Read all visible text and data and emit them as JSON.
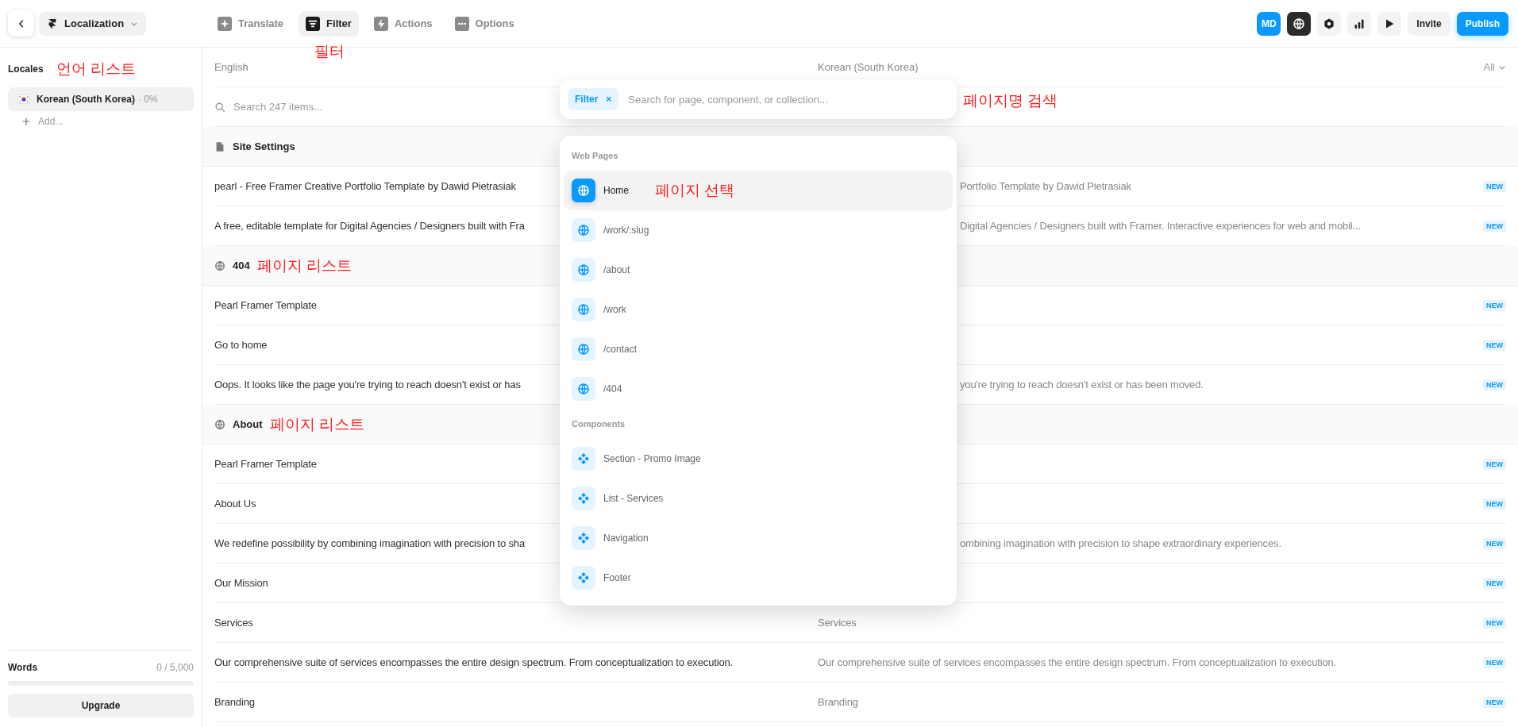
{
  "topbar": {
    "project": "Localization",
    "tabs": [
      {
        "label": "Translate",
        "selected": false
      },
      {
        "label": "Filter",
        "selected": true,
        "annotation": "필터"
      },
      {
        "label": "Actions",
        "selected": false
      },
      {
        "label": "Options",
        "selected": false
      }
    ],
    "avatar": "MD",
    "invite": "Invite",
    "publish": "Publish"
  },
  "sidebar": {
    "heading": "Locales",
    "annotation": "언어 리스트",
    "locales": [
      {
        "name": "Korean (South Korea)",
        "progress": "· 0%",
        "selected": true
      }
    ],
    "add": "Add...",
    "usage": {
      "label": "Words",
      "count": "0 / 5,000",
      "level": 0
    },
    "upgrade": "Upgrade"
  },
  "table": {
    "source_language": "English",
    "target_language": "Korean (South Korea)",
    "filter": "All",
    "search_placeholder": "Search 247 items...",
    "groups": [
      {
        "kind": "settings",
        "title": "Site Settings",
        "rows": [
          {
            "source": "pearl - Free Framer Creative Portfolio Template by Dawid Pietrasiak",
            "target": "Portfolio Template by Dawid Pietrasiak",
            "badge": "NEW"
          },
          {
            "source": "A free, editable template for Digital Agencies / Designers built with Fra",
            "target": "Digital Agencies / Designers built with Framer. Interactive experiences for web and mobil...",
            "badge": "NEW"
          }
        ]
      },
      {
        "kind": "page",
        "title": "404",
        "annotation": "페이지 리스트",
        "rows": [
          {
            "source": "Pearl Framer Template",
            "badge": "NEW"
          },
          {
            "source": "Go to home",
            "badge": "NEW"
          },
          {
            "source": "Oops. It looks like the page you're trying to reach doesn't exist or has",
            "target": "you're trying to reach doesn't exist or has been moved.",
            "badge": "NEW"
          }
        ]
      },
      {
        "kind": "page",
        "title": "About",
        "annotation": "페이지 리스트",
        "rows": [
          {
            "source": "Pearl Framer Template",
            "badge": "NEW"
          },
          {
            "source": "About Us",
            "badge": "NEW"
          },
          {
            "source": "We redefine possibility by combining imagination with precision to sha",
            "target": "ombining imagination with precision to shape extraordinary experiences.",
            "badge": "NEW"
          },
          {
            "source": "Our Mission",
            "badge": "NEW"
          },
          {
            "source": "Services",
            "target": "Services",
            "badge": "NEW"
          },
          {
            "source": "Our comprehensive suite of services encompasses the entire design spectrum. From conceptualization to execution.",
            "target": "Our comprehensive suite of services encompasses the entire design spectrum. From conceptualization to execution.",
            "badge": "NEW"
          },
          {
            "source": "Branding",
            "target": "Branding",
            "badge": "NEW"
          }
        ]
      }
    ]
  },
  "filter_popup": {
    "chip": "Filter",
    "chip_close": "×",
    "placeholder": "Search for page, component, or collection...",
    "annotation": "페이지명 검색",
    "sections": [
      {
        "title": "Web Pages",
        "kind": "page",
        "items": [
          {
            "label": "Home",
            "selected": true,
            "annotation": "페이지 선택"
          },
          {
            "label": "/work/:slug",
            "selected": false
          },
          {
            "label": "/about",
            "selected": false
          },
          {
            "label": "/work",
            "selected": false
          },
          {
            "label": "/contact",
            "selected": false
          },
          {
            "label": "/404",
            "selected": false
          }
        ]
      },
      {
        "title": "Components",
        "kind": "component",
        "items": [
          {
            "label": "Section - Promo Image",
            "selected": false
          },
          {
            "label": "List - Services",
            "selected": false
          },
          {
            "label": "Navigation",
            "selected": false
          },
          {
            "label": "Footer",
            "selected": false
          }
        ]
      }
    ]
  }
}
